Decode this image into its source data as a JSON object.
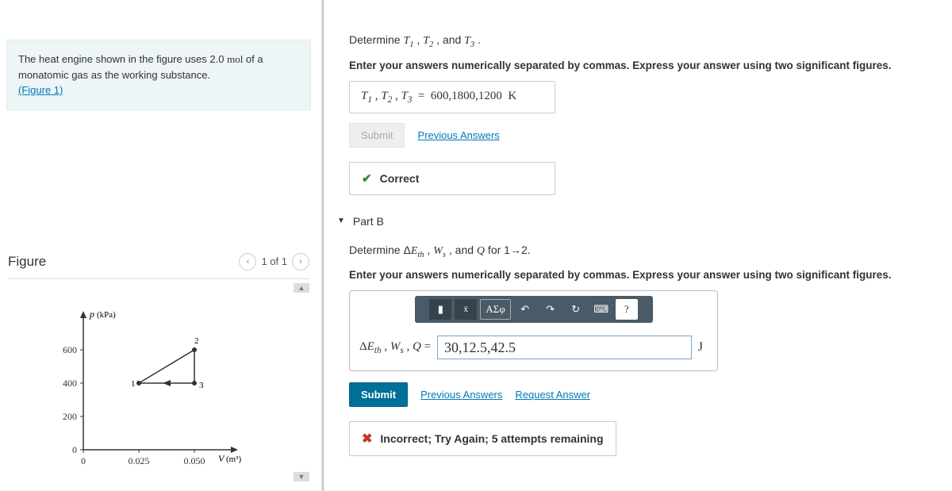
{
  "problem": {
    "text_pre": "The heat engine shown in the figure uses 2.0 ",
    "mol": "mol",
    "text_mid": " of a monatomic gas as the working substance.",
    "figure_link": "(Figure 1)"
  },
  "figure_panel": {
    "title": "Figure",
    "pager": "1 of 1"
  },
  "chart_data": {
    "type": "line",
    "title": "",
    "xlabel": "V (m³)",
    "ylabel": "p (kPa)",
    "xlim": [
      0,
      0.06
    ],
    "ylim": [
      0,
      700
    ],
    "xticks": [
      0,
      0.025,
      0.05
    ],
    "yticks": [
      0,
      200,
      400,
      600
    ],
    "points": [
      {
        "name": "1",
        "x": 0.025,
        "y": 400
      },
      {
        "name": "2",
        "x": 0.05,
        "y": 600
      },
      {
        "name": "3",
        "x": 0.05,
        "y": 400
      }
    ],
    "cycle": [
      "1",
      "2",
      "3",
      "1"
    ],
    "arrow_segment": [
      "3",
      "1"
    ]
  },
  "partA": {
    "prompt_html": "Determine <i>T</i><sub>1</sub> , <i>T</i><sub>2</sub> , and <i>T</i><sub>3</sub> .",
    "instructions": "Enter your answers numerically separated by commas. Express your answer using two significant figures.",
    "answer_lhs": "T₁ , T₂ , T₃  =  ",
    "answer_value": "600,1800,1200",
    "answer_unit": "K",
    "submit_label": "Submit",
    "prev_link": "Previous Answers",
    "feedback": "Correct"
  },
  "partB": {
    "header": "Part B",
    "prompt_html": "Determine Δ<i>E</i><sub>th</sub> , <i>W</i><sub>s</sub> , and <i>Q</i> for 1→2.",
    "instructions": "Enter your answers numerically separated by commas. Express your answer using two significant figures.",
    "toolbar": {
      "group1": "■",
      "group2": "√x",
      "group3": "ΑΣφ",
      "undo": "↶",
      "redo": "↷",
      "reset": "↻",
      "kb": "⌨",
      "help": "?"
    },
    "answer_lhs": "ΔEₜₕ , Wₛ , Q =",
    "answer_value": "30,12.5,42.5",
    "answer_unit": "J",
    "submit_label": "Submit",
    "prev_link": "Previous Answers",
    "request_link": "Request Answer",
    "feedback": "Incorrect; Try Again; 5 attempts remaining"
  }
}
